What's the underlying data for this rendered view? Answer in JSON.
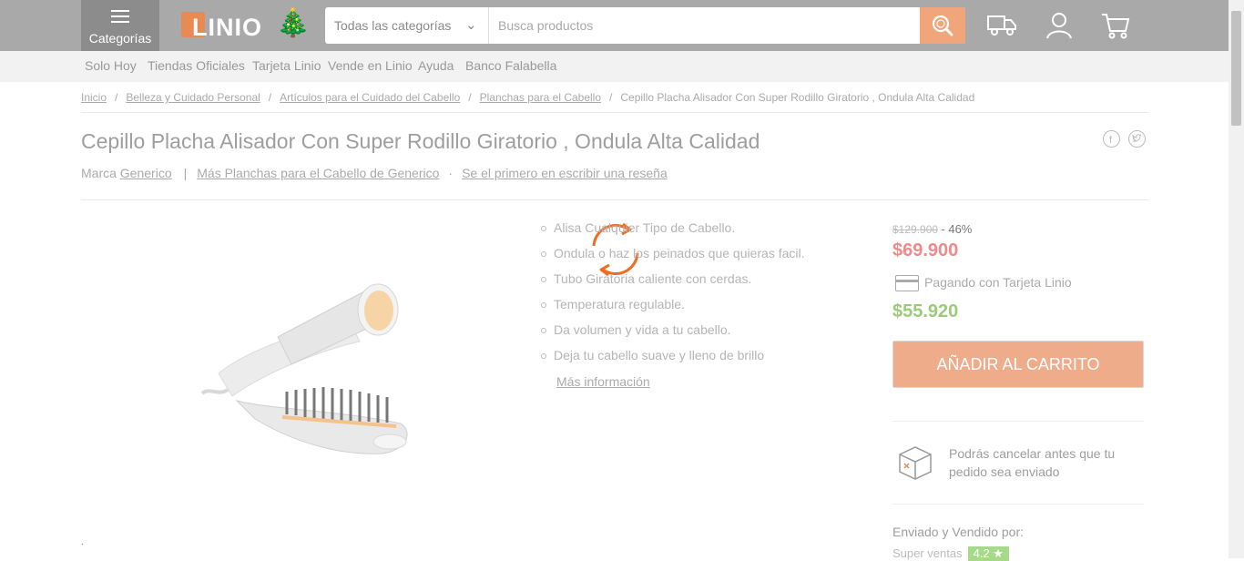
{
  "header": {
    "categories_label": "Categorías",
    "logo_text": "LINIO",
    "search": {
      "category_selected": "Todas las categorías",
      "placeholder": "Busca productos"
    }
  },
  "subnav": {
    "items": [
      "Solo Hoy",
      "Tiendas Oficiales",
      "Tarjeta Linio",
      "Vende en Linio",
      "Ayuda",
      "Banco Falabella"
    ]
  },
  "breadcrumb": {
    "items": [
      "Inicio",
      "Belleza y Cuidado Personal",
      "Artículos para el Cuidado del Cabello",
      "Planchas para el Cabello"
    ],
    "current": "Cepillo Placha Alisador Con Super Rodillo Giratorio , Ondula Alta Calidad",
    "separator": "/"
  },
  "product": {
    "title": "Cepillo Placha Alisador Con Super Rodillo Giratorio , Ondula Alta Calidad",
    "brand_prefix": "Marca",
    "brand": "Generico",
    "more_link": "Más Planchas para el Cabello de Generico",
    "review_link": "Se el primero en escribir una reseña",
    "features": [
      "Alisa Cualquier Tipo de Cabello.",
      "Ondula o haz los peinados que quieras facil.",
      "Tubo Giratoria caliente con cerdas.",
      "Temperatura regulable.",
      "Da volumen y vida a tu cabello.",
      "Deja tu cabello suave y lleno de brillo"
    ],
    "more_info": "Más información"
  },
  "pricing": {
    "old_price": "$129.900",
    "discount": "- 46%",
    "price": "$69.900",
    "card_label": "Pagando con Tarjeta Linio",
    "card_price": "$55.920",
    "add_to_cart": "AÑADIR AL CARRITO",
    "cancel_note": "Podrás cancelar antes que tu pedido sea enviado",
    "sold_by": "Enviado y Vendido por:",
    "seller_label": "Super ventas",
    "rating": "4.2 ★"
  },
  "colors": {
    "accent": "#f0a67a",
    "price": "#ef8a8a",
    "card_price": "#9acb7a",
    "spinner": "#f36a21"
  }
}
